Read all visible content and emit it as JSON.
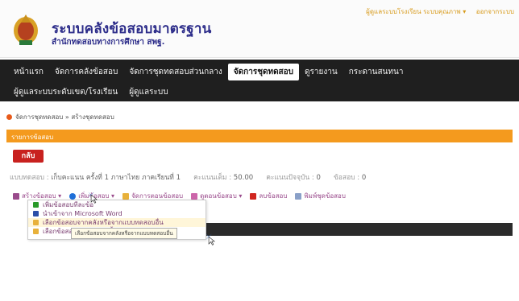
{
  "header": {
    "title": "ระบบคลังข้อสอบมาตรฐาน",
    "subtitle": "สำนักทดสอบทางการศึกษา สพฐ.",
    "user_links": [
      "ผู้ดูแลระบบโรงเรียน ระบบคุณภาพ ▾",
      "ออกจากระบบ"
    ]
  },
  "nav": {
    "row1": [
      "หน้าแรก",
      "จัดการคลังข้อสอบ",
      "จัดการชุดทดสอบส่วนกลาง",
      "จัดการชุดทดสอบ",
      "ดูรายงาน",
      "กระดานสนทนา"
    ],
    "row2": [
      "ผู้ดูแลระบบระดับเขต/โรงเรียน",
      "ผู้ดูแลระบบ"
    ],
    "active": "จัดการชุดทดสอบ"
  },
  "breadcrumb": "จัดการชุดทดสอบ » สร้างชุดทดสอบ",
  "panel": {
    "title": "รายการข้อสอบ"
  },
  "back_button": "กลับ",
  "info": {
    "test_label": "แบบทดสอบ :",
    "test_name": "เก็บคะแนน ครั้งที่ 1 ภาษาไทย ภาคเรียนที่ 1",
    "full_score_label": "คะแนนเต็ม :",
    "full_score": "50.00",
    "current_score_label": "คะแนนปัจจุบัน :",
    "current_score": "0",
    "item_count_label": "ข้อสอบ :",
    "item_count": "0"
  },
  "toolbar": {
    "items": [
      {
        "label": "สร้างข้อสอบ ▾",
        "icon": "edit-icon",
        "color": "#9a4b8c"
      },
      {
        "label": "เพิ่มข้อสอบ ▾",
        "icon": "add-icon",
        "color": "#1f6fd8"
      },
      {
        "label": "จัดการตอนข้อสอบ",
        "icon": "section-icon",
        "color": "#e8b13a"
      },
      {
        "label": "ดูตอนข้อสอบ ▾",
        "icon": "view-icon",
        "color": "#cc66aa"
      },
      {
        "label": "ลบข้อสอบ",
        "icon": "delete-icon",
        "color": "#d0251f"
      },
      {
        "label": "พิมพ์ชุดข้อสอบ",
        "icon": "print-icon",
        "color": "#8aa0c8"
      }
    ]
  },
  "dropdown": {
    "items": [
      {
        "label": "เพิ่มข้อสอบทีละข้อ",
        "icon": "plus-icon",
        "color": "#2a9a2a"
      },
      {
        "label": "นำเข้าจาก Microsoft Word",
        "icon": "word-icon",
        "color": "#2b4ea8"
      },
      {
        "label": "เลือกข้อสอบจากคลังหรือจากแบบทดสอบอื่น",
        "icon": "folder-icon",
        "color": "#e8b13a"
      },
      {
        "label": "เลือกข้อสอบจากแผนตัวชี้วัด",
        "icon": "table-icon",
        "color": "#e8b13a"
      }
    ],
    "tooltip": "เลือกข้อสอบจากคลังหรือจากแบบทดสอบอื่น"
  }
}
